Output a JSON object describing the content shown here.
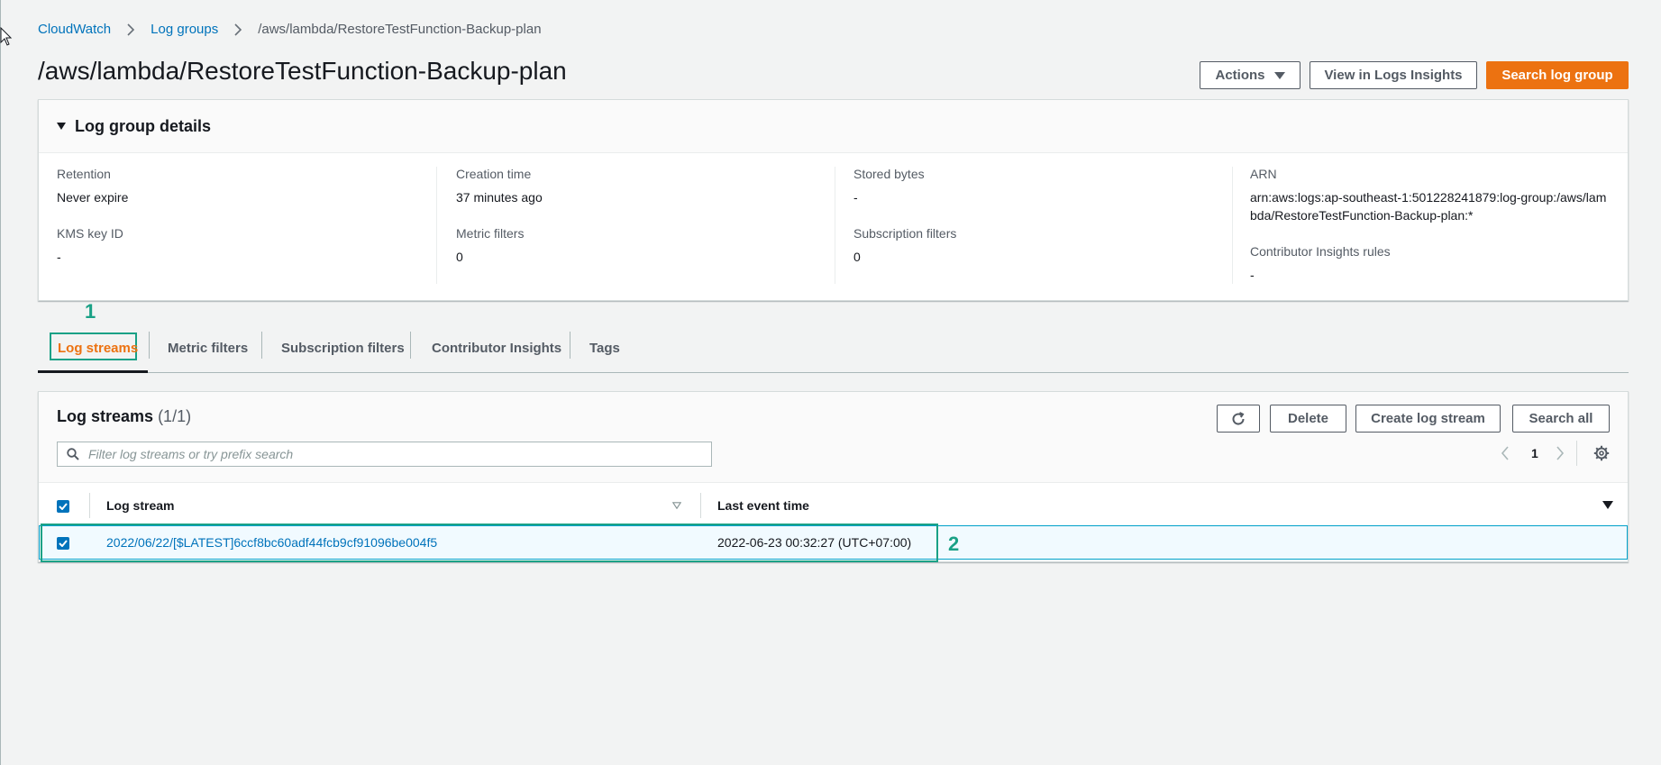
{
  "breadcrumb": {
    "items": [
      "CloudWatch",
      "Log groups"
    ],
    "current": "/aws/lambda/RestoreTestFunction-Backup-plan"
  },
  "page": {
    "title": "/aws/lambda/RestoreTestFunction-Backup-plan"
  },
  "header_actions": {
    "actions": "Actions",
    "view_insights": "View in Logs Insights",
    "search_log_group": "Search log group"
  },
  "details": {
    "title": "Log group details",
    "retention_label": "Retention",
    "retention_value": "Never expire",
    "kms_label": "KMS key ID",
    "kms_value": "-",
    "creation_label": "Creation time",
    "creation_value": "37 minutes ago",
    "metric_filters_label": "Metric filters",
    "metric_filters_value": "0",
    "stored_bytes_label": "Stored bytes",
    "stored_bytes_value": "-",
    "subscription_filters_label": "Subscription filters",
    "subscription_filters_value": "0",
    "arn_label": "ARN",
    "arn_value": "arn:aws:logs:ap-southeast-1:501228241879:log-group:/aws/lambda/RestoreTestFunction-Backup-plan:*",
    "contributor_rules_label": "Contributor Insights rules",
    "contributor_rules_value": "-"
  },
  "annotations": {
    "marker1": "1",
    "marker2": "2"
  },
  "tabs": {
    "log_streams": "Log streams",
    "metric_filters": "Metric filters",
    "subscription_filters": "Subscription filters",
    "contributor_insights": "Contributor Insights",
    "tags": "Tags"
  },
  "streams": {
    "title": "Log streams",
    "count": "(1/1)",
    "delete": "Delete",
    "create": "Create log stream",
    "search_all": "Search all",
    "search_placeholder": "Filter log streams or try prefix search",
    "page_number": "1",
    "col_log_stream": "Log stream",
    "col_last_event": "Last event time",
    "rows": [
      {
        "name": "2022/06/22/[$LATEST]6ccf8bc60adf44fcb9cf91096be004f5",
        "last_event": "2022-06-23 00:32:27 (UTC+07:00)",
        "selected": true
      }
    ]
  },
  "colors": {
    "link": "#0073bb",
    "primary": "#ec7211",
    "annotation": "#1aa186",
    "background": "#f2f3f3"
  },
  "icons": [
    "mouse-cursor-icon",
    "chevron-right-icon",
    "caret-down-icon",
    "refresh-icon",
    "search-icon",
    "chevron-left-icon",
    "gear-icon",
    "sort-icon",
    "checkmark-icon"
  ]
}
